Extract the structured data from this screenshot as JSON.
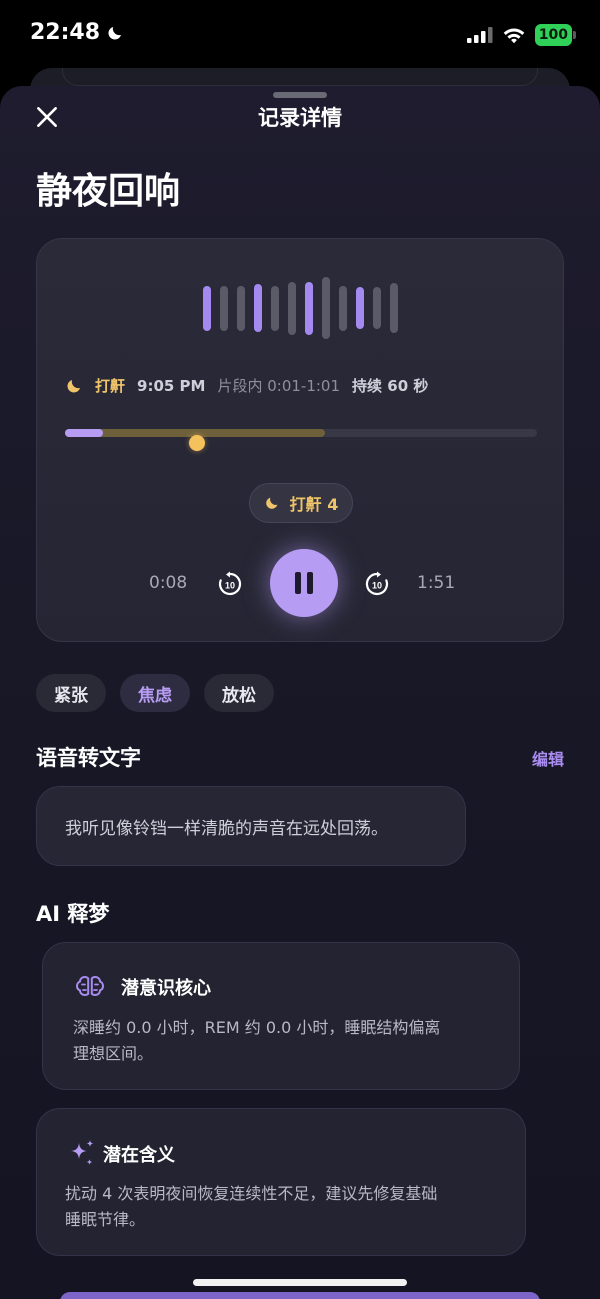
{
  "status_bar": {
    "time": "22:48",
    "battery": "100"
  },
  "header": {
    "title": "记录详情"
  },
  "page_title": "静夜回响",
  "player": {
    "wave_colors": {
      "accent": "#a48af0",
      "muted": "#5b5b68"
    },
    "wave_bars": [
      {
        "level": 0.72,
        "accent": true
      },
      {
        "level": 0.72,
        "accent": false
      },
      {
        "level": 0.72,
        "accent": false
      },
      {
        "level": 0.78,
        "accent": true
      },
      {
        "level": 0.72,
        "accent": false
      },
      {
        "level": 0.85,
        "accent": false
      },
      {
        "level": 0.85,
        "accent": true
      },
      {
        "level": 1.0,
        "accent": false
      },
      {
        "level": 0.72,
        "accent": false
      },
      {
        "level": 0.68,
        "accent": true
      },
      {
        "level": 0.68,
        "accent": false
      },
      {
        "level": 0.8,
        "accent": false
      }
    ],
    "event_icon": "moon-icon",
    "event_type": "打鼾",
    "event_time": "9:05 PM",
    "segment_range": "片段内 0:01-1:01",
    "duration": "持续 60 秒",
    "segment_fraction": 0.55,
    "played_fraction": 0.08,
    "knob_fraction": 0.28,
    "snore_pill": "打鼾 4",
    "current_time": "0:08",
    "total_time": "1:51",
    "skip_back_label": "10",
    "skip_forward_label": "10"
  },
  "moods": [
    {
      "label": "紧张",
      "active": false
    },
    {
      "label": "焦虑",
      "active": true
    },
    {
      "label": "放松",
      "active": false
    }
  ],
  "transcript_section": {
    "title": "语音转文字",
    "edit_label": "编辑",
    "text": "我听见像铃铛一样清脆的声音在远处回荡。"
  },
  "ai_section": {
    "title": "AI 释梦",
    "cards": [
      {
        "icon": "brain-icon",
        "title": "潜意识核心",
        "body_line1": "深睡约 0.0 小时，REM 约 0.0 小时，睡眠结构偏离",
        "body_line2": "理想区间。"
      },
      {
        "icon": "sparkle-icon",
        "title": "潜在含义",
        "body_line1": "扰动 4 次表明夜间恢复连续性不足，建议先修复基础",
        "body_line2": "睡眠节律。"
      }
    ]
  },
  "colors": {
    "accent": "#b79cf4",
    "gold": "#f0c46a"
  }
}
